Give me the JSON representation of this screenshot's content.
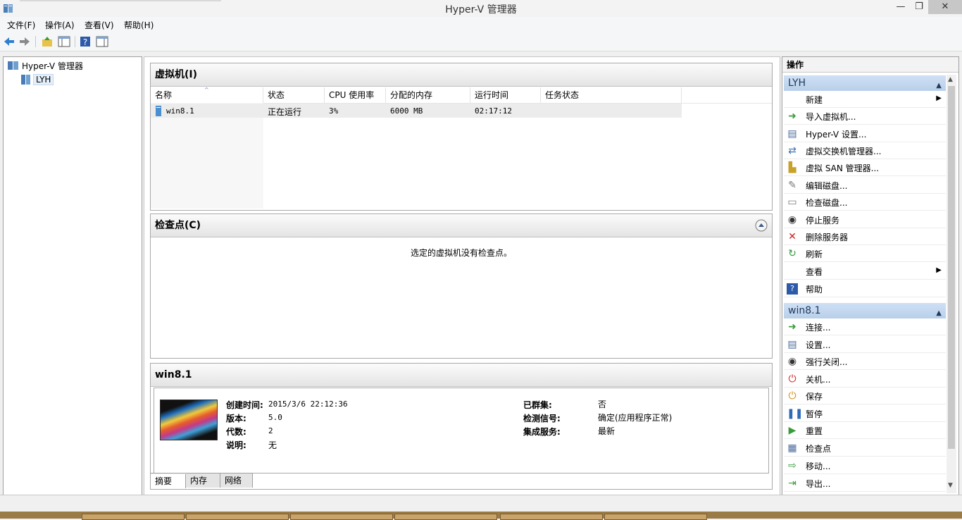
{
  "window": {
    "title": "Hyper-V 管理器"
  },
  "menu": [
    "文件(F)",
    "操作(A)",
    "查看(V)",
    "帮助(H)"
  ],
  "tree": {
    "root": "Hyper-V 管理器",
    "server": "LYH"
  },
  "vm_pane": {
    "title": "虚拟机(I)",
    "columns": [
      "名称",
      "状态",
      "CPU 使用率",
      "分配的内存",
      "运行时间",
      "任务状态"
    ],
    "row": {
      "name": "win8.1",
      "status": "正在运行",
      "cpu": "3%",
      "memory": "6000 MB",
      "uptime": "02:17:12",
      "task": ""
    }
  },
  "checkpoint_pane": {
    "title": "检查点(C)",
    "empty_text": "选定的虚拟机没有检查点。"
  },
  "details_pane": {
    "title": "win8.1",
    "left": [
      {
        "label": "创建时间:",
        "value": "2015/3/6 22:12:36"
      },
      {
        "label": "版本:",
        "value": "5.0"
      },
      {
        "label": "代数:",
        "value": "2"
      },
      {
        "label": "说明:",
        "value": "无"
      }
    ],
    "right": [
      {
        "label": "已群集:",
        "value": "否"
      },
      {
        "label": "检测信号:",
        "value": "确定(应用程序正常)"
      },
      {
        "label": "集成服务:",
        "value": "最新"
      }
    ],
    "tabs": [
      "摘要",
      "内存",
      "网络"
    ]
  },
  "actions": {
    "header": "操作",
    "section_server": "LYH",
    "server_items": [
      "新建",
      "导入虚拟机...",
      "Hyper-V 设置...",
      "虚拟交换机管理器...",
      "虚拟 SAN 管理器...",
      "编辑磁盘...",
      "检查磁盘...",
      "停止服务",
      "删除服务器",
      "刷新",
      "查看",
      "帮助"
    ],
    "section_vm": "win8.1",
    "vm_items": [
      "连接...",
      "设置...",
      "强行关闭...",
      "关机...",
      "保存",
      "暂停",
      "重置",
      "检查点",
      "移动...",
      "导出..."
    ]
  }
}
